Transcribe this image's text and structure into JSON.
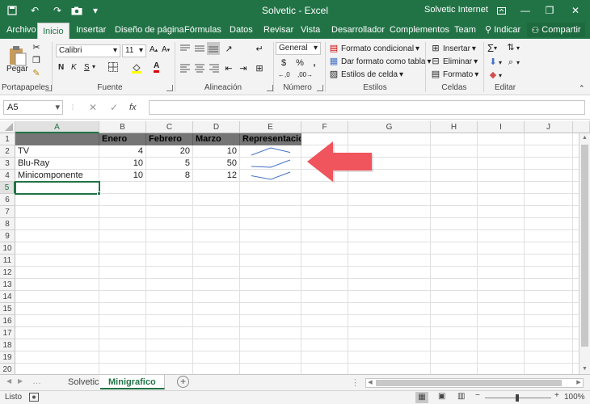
{
  "window": {
    "title": "Solvetic  -  Excel",
    "user": "Solvetic Internet"
  },
  "quick_access": {
    "save_icon": "save-icon",
    "undo_icon": "undo-icon",
    "redo_icon": "redo-icon",
    "camera_icon": "camera-icon",
    "customize_icon": "customize-icon"
  },
  "ribbon_tabs": [
    "Archivo",
    "Inicio",
    "Insertar",
    "Diseño de página",
    "Fórmulas",
    "Datos",
    "Revisar",
    "Vista",
    "Desarrollador",
    "Complementos",
    "Team"
  ],
  "tell_me": "Indicar",
  "share_label": "Compartir",
  "groups": {
    "clipboard": {
      "label": "Portapapeles",
      "paste": "Pegar"
    },
    "font": {
      "label": "Fuente",
      "name": "Calibri",
      "size": "11"
    },
    "alignment": {
      "label": "Alineación"
    },
    "number": {
      "label": "Número",
      "format": "General"
    },
    "styles": {
      "label": "Estilos",
      "conditional": "Formato condicional",
      "table": "Dar formato como tabla",
      "cell_styles": "Estilos de celda"
    },
    "cells": {
      "label": "Celdas",
      "insert": "Insertar",
      "delete": "Eliminar",
      "format": "Formato"
    },
    "editing": {
      "label": "Editar"
    }
  },
  "formula_bar": {
    "name_box": "A5",
    "fx": "fx",
    "value": ""
  },
  "columns": [
    "A",
    "B",
    "C",
    "D",
    "E",
    "F",
    "G",
    "H",
    "I",
    "J"
  ],
  "rows": [
    "1",
    "2",
    "3",
    "4",
    "5",
    "6",
    "7",
    "8",
    "9",
    "10",
    "11",
    "12",
    "13",
    "14",
    "15",
    "16",
    "17",
    "18",
    "19",
    "20"
  ],
  "table": {
    "headers": [
      "",
      "Enero",
      "Febrero",
      "Marzo",
      "Representacion"
    ],
    "data": [
      {
        "name": "TV",
        "values": [
          4,
          20,
          10
        ]
      },
      {
        "name": "Blu-Ray",
        "values": [
          10,
          5,
          50
        ]
      },
      {
        "name": "Minicomponente",
        "values": [
          10,
          8,
          12
        ]
      }
    ]
  },
  "sparkline_color": "#4472c4",
  "arrow_color": "#f0545c",
  "sheets": [
    "Solvetic",
    "Minigrafico"
  ],
  "active_sheet": "Minigrafico",
  "status": {
    "ready": "Listo",
    "zoom": "100%"
  }
}
